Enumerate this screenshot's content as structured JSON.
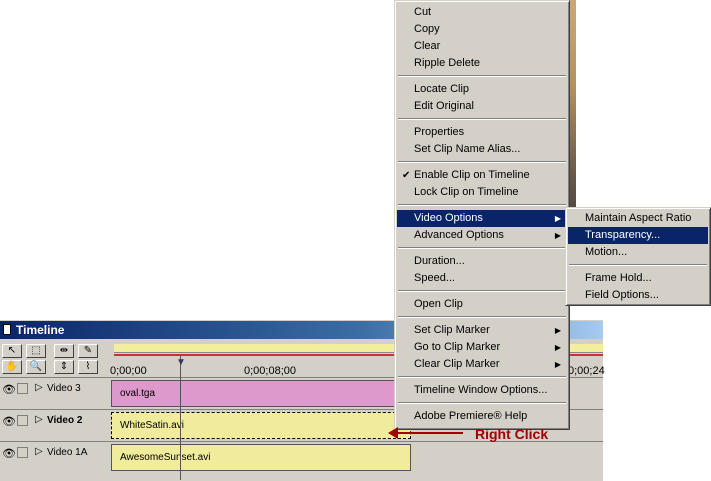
{
  "timeline": {
    "title": "Timeline",
    "ruler": {
      "t0": "0;00;00",
      "t1": "0;00;08;00",
      "t2": "0;00;24"
    },
    "tracks": [
      {
        "name": "Video 3",
        "clip": "oval.tga",
        "bold": false
      },
      {
        "name": "Video 2",
        "clip": "WhiteSatin.avi",
        "bold": true
      },
      {
        "name": "Video 1A",
        "clip": "AwesomeSunset.avi",
        "bold": false
      }
    ]
  },
  "context_menu": {
    "items": [
      "Cut",
      "Copy",
      "Clear",
      "Ripple Delete",
      "Locate Clip",
      "Edit Original",
      "Properties",
      "Set Clip Name Alias...",
      "Enable Clip on Timeline",
      "Lock Clip on Timeline",
      "Video Options",
      "Advanced Options",
      "Duration...",
      "Speed...",
      "Open Clip",
      "Set Clip Marker",
      "Go to Clip Marker",
      "Clear Clip Marker",
      "Timeline Window Options...",
      "Adobe Premiere® Help"
    ]
  },
  "submenu": {
    "items": [
      "Maintain Aspect Ratio",
      "Transparency...",
      "Motion...",
      "Frame Hold...",
      "Field Options..."
    ]
  },
  "annotation": {
    "text": "Right Click"
  },
  "colors": {
    "highlight": "#0a246a",
    "annotation": "#a00000",
    "clip_pink": "#dd98cc",
    "clip_yellow": "#f0ec9c"
  }
}
